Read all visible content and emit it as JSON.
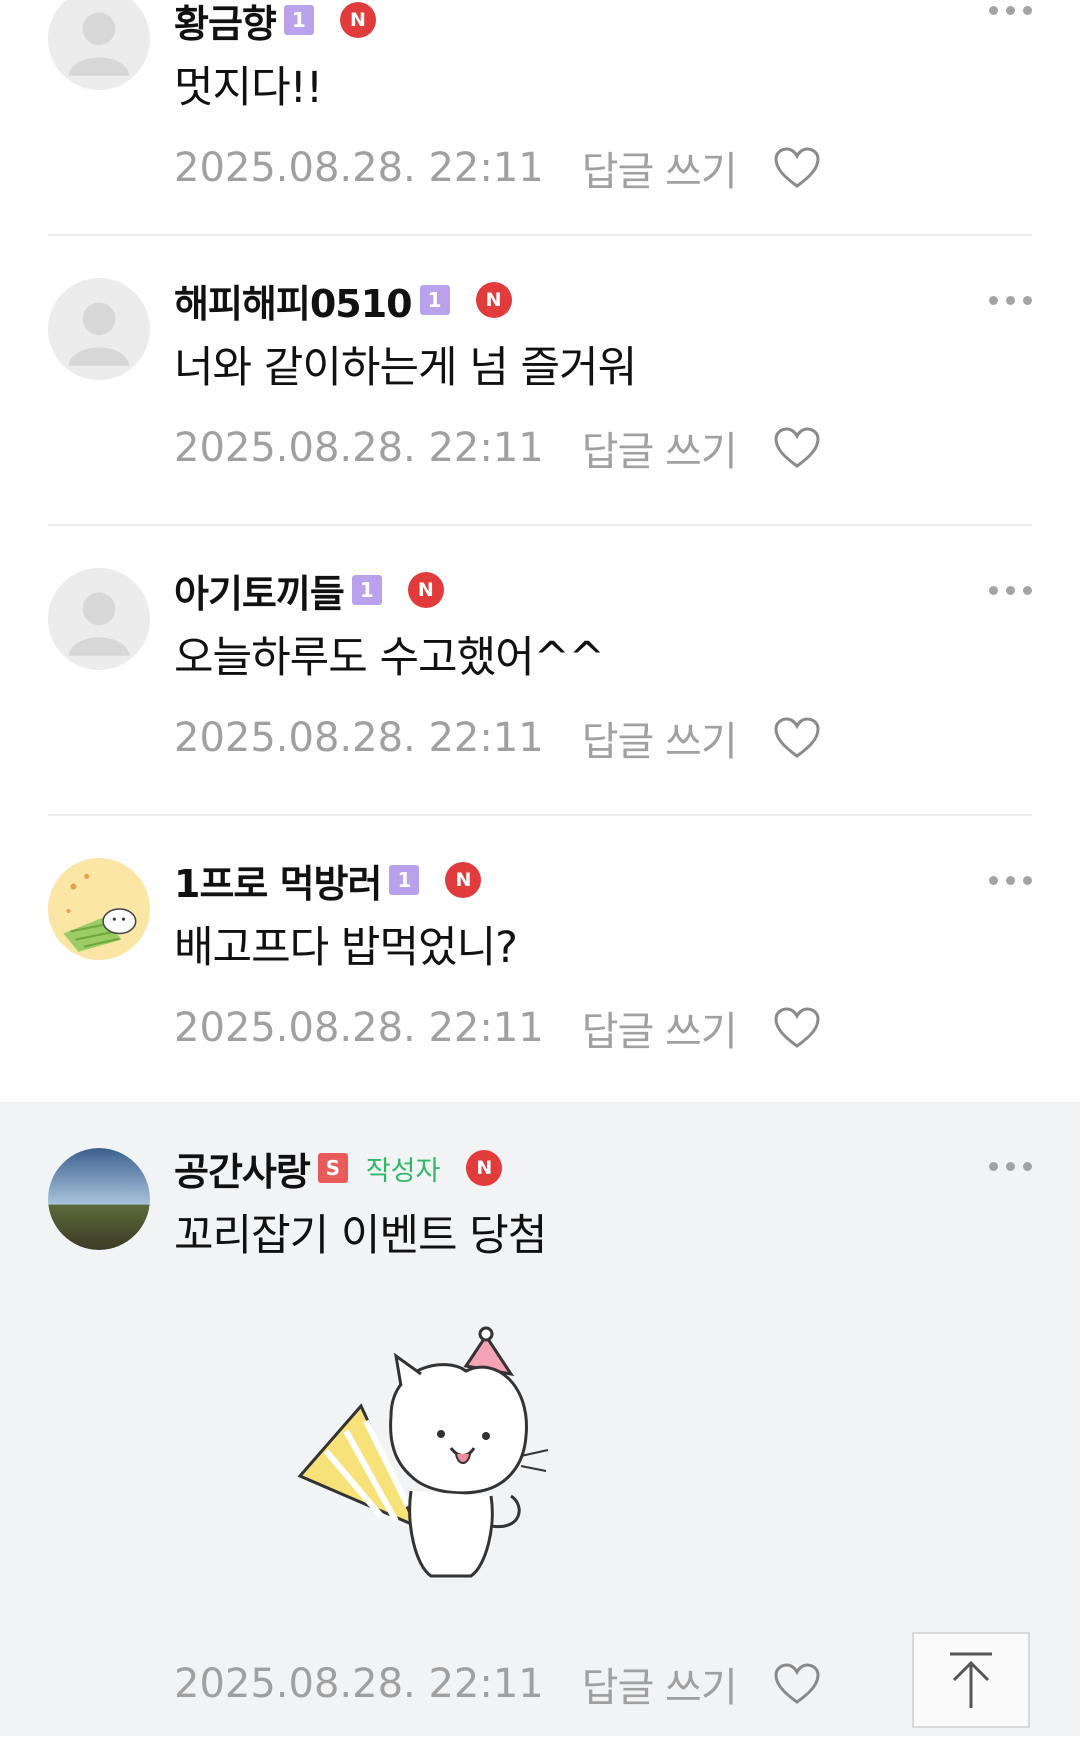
{
  "comments": [
    {
      "nick": "황금향",
      "level": "1",
      "new_badge": "N",
      "text": "멋지다!!",
      "time": "2025.08.28. 22:11",
      "reply": "답글 쓰기"
    },
    {
      "nick": "해피해피0510",
      "level": "1",
      "new_badge": "N",
      "text": "너와 같이하는게 넘 즐거워",
      "time": "2025.08.28. 22:11",
      "reply": "답글 쓰기"
    },
    {
      "nick": "아기토끼들",
      "level": "1",
      "new_badge": "N",
      "text": "오늘하루도 수고했어^^",
      "time": "2025.08.28. 22:11",
      "reply": "답글 쓰기"
    },
    {
      "nick": "1프로 먹방러",
      "level": "1",
      "new_badge": "N",
      "text": "배고프다 밥먹었니?",
      "time": "2025.08.28. 22:11",
      "reply": "답글 쓰기"
    },
    {
      "nick": "공간사랑",
      "level": "S",
      "writer_badge": "작성자",
      "new_badge": "N",
      "text": "꼬리잡기 이벤트 당첨",
      "time": "2025.08.28. 22:11",
      "reply": "답글 쓰기"
    }
  ],
  "colors": {
    "level_purple": "#b9a2eb",
    "level_red": "#e95b5b",
    "writer_green": "#2fb868",
    "new_red": "#e23b3b",
    "meta_gray": "#a0a0a0",
    "writer_bg": "#f2f3f5"
  },
  "icons": {
    "more": "more-dots-icon",
    "like": "heart-outline-icon",
    "scroll_top": "arrow-up-icon"
  }
}
